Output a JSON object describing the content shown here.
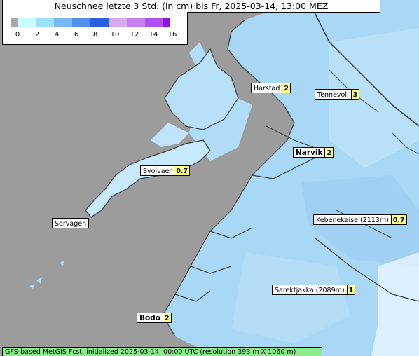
{
  "title": "Neuschnee letzte 3 Std. (in cm) bis Fr, 2025-03-14, 13:00 MEZ",
  "legend": {
    "ticks": [
      "0",
      "2",
      "4",
      "6",
      "8",
      "10",
      "12",
      "14",
      "16"
    ],
    "colors": [
      "#aaaaaa",
      "#c8ffff",
      "#a0e0ff",
      "#7ab8f5",
      "#5090e8",
      "#2860e0",
      "#d8a8f0",
      "#c880f0",
      "#b050f0",
      "#9010e8"
    ]
  },
  "places": [
    {
      "name": "Harstad",
      "value": "2",
      "bold": false
    },
    {
      "name": "Tennevoll",
      "value": "3",
      "bold": false
    },
    {
      "name": "Narvik",
      "value": "2",
      "bold": true
    },
    {
      "name": "Svolvaer",
      "value": "0.7",
      "bold": false
    },
    {
      "name": "Sorvagen",
      "value": "",
      "bold": false
    },
    {
      "name": "Kebenekaise (2113m)",
      "value": "0.7",
      "bold": false
    },
    {
      "name": "Sarektjakka (2089m)",
      "value": "1",
      "bold": false
    },
    {
      "name": "Bodo",
      "value": "2",
      "bold": true
    }
  ],
  "footer": "GFS-based MetGIS Fcst, initialized 2025-03-14, 00:00 UTC  (resolution 393 m X 1060 m)",
  "colors": {
    "sea": "#9c9c9c",
    "land": "#a0d8f8",
    "snow_light": "#c8f0ff",
    "snow_medium": "#7ab8f5",
    "label_value_bg": "#ffff8c",
    "footer_bg": "#8ceb8c"
  }
}
